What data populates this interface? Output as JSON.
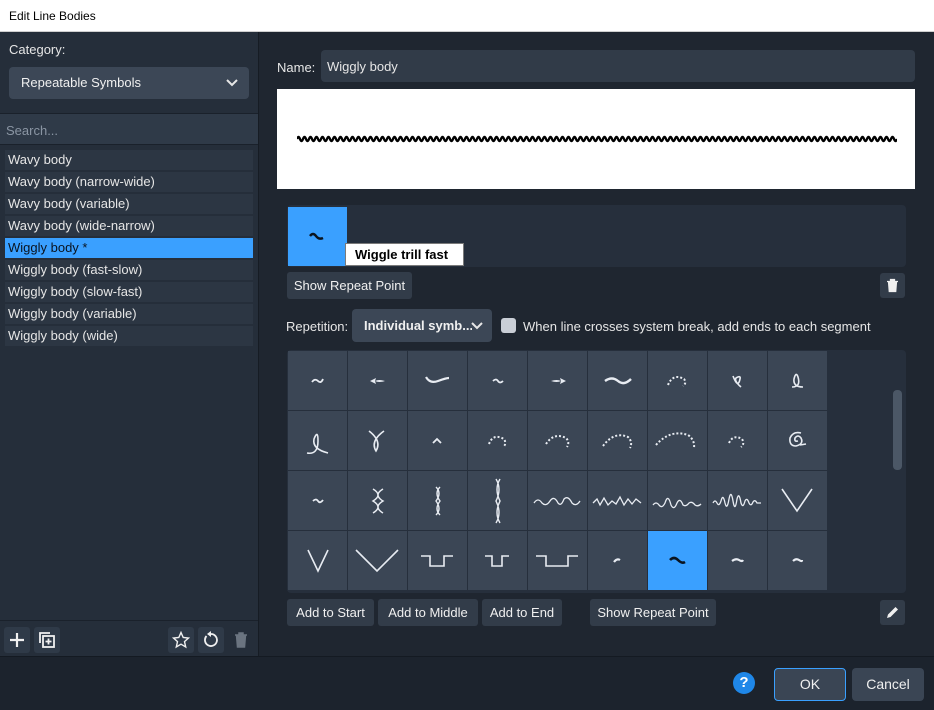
{
  "window": {
    "title": "Edit Line Bodies"
  },
  "sidebar": {
    "category_label": "Category:",
    "category_value": "Repeatable Symbols",
    "search_placeholder": "Search...",
    "items": [
      {
        "label": "Wavy body",
        "selected": false
      },
      {
        "label": "Wavy body (narrow-wide)",
        "selected": false
      },
      {
        "label": "Wavy body (variable)",
        "selected": false
      },
      {
        "label": "Wavy body (wide-narrow)",
        "selected": false
      },
      {
        "label": "Wiggly body *",
        "selected": true
      },
      {
        "label": "Wiggly body (fast-slow)",
        "selected": false
      },
      {
        "label": "Wiggly body (slow-fast)",
        "selected": false
      },
      {
        "label": "Wiggly body (variable)",
        "selected": false
      },
      {
        "label": "Wiggly body (wide)",
        "selected": false
      }
    ],
    "footer_icons": [
      "add-icon",
      "duplicate-icon",
      "star-icon",
      "revert-icon",
      "delete-icon"
    ]
  },
  "editor": {
    "name_label": "Name:",
    "name_value": "Wiggly body",
    "tooltip": "Wiggle trill fast",
    "show_repeat_point": "Show Repeat Point",
    "repetition_label": "Repetition:",
    "repetition_value": "Individual symb...",
    "system_break_label": "When line crosses system break, add ends to each segment",
    "system_break_checked": false,
    "symbol_rows": [
      [
        "wiggle-small",
        "wiggle-arrow-left",
        "wiggle-sweep",
        "wiggle-tilde",
        "wiggle-arrow-right",
        "wiggle-wide",
        "arc-dotted-small",
        "loop-small",
        "loop-tall"
      ],
      [
        "loop-large",
        "loop-twisted",
        "caret",
        "arc-dotted-hook",
        "arc-dotted-medium",
        "arc-dotted-wide",
        "arc-dotted-large",
        "arc-dotted-hook-small",
        "spiral"
      ],
      [
        "tilde-small",
        "vibrato-knots",
        "vibrato-thin",
        "vibrato-tall",
        "wave-irregular",
        "wave-jagged",
        "wave-tremolo",
        "wave-dense",
        "v-shape"
      ],
      [
        "v-narrow",
        "v-wide",
        "square-wave",
        "square-wave-narrow",
        "square-wave-wide",
        "dot-small",
        "wiggle-trill-fast",
        "dash-small",
        "dash-tiny"
      ]
    ],
    "selected_symbol": "wiggle-trill-fast",
    "add_to_start": "Add to Start",
    "add_to_middle": "Add to Middle",
    "add_to_end": "Add to End"
  },
  "footer": {
    "help_label": "?",
    "ok_label": "OK",
    "cancel_label": "Cancel"
  }
}
